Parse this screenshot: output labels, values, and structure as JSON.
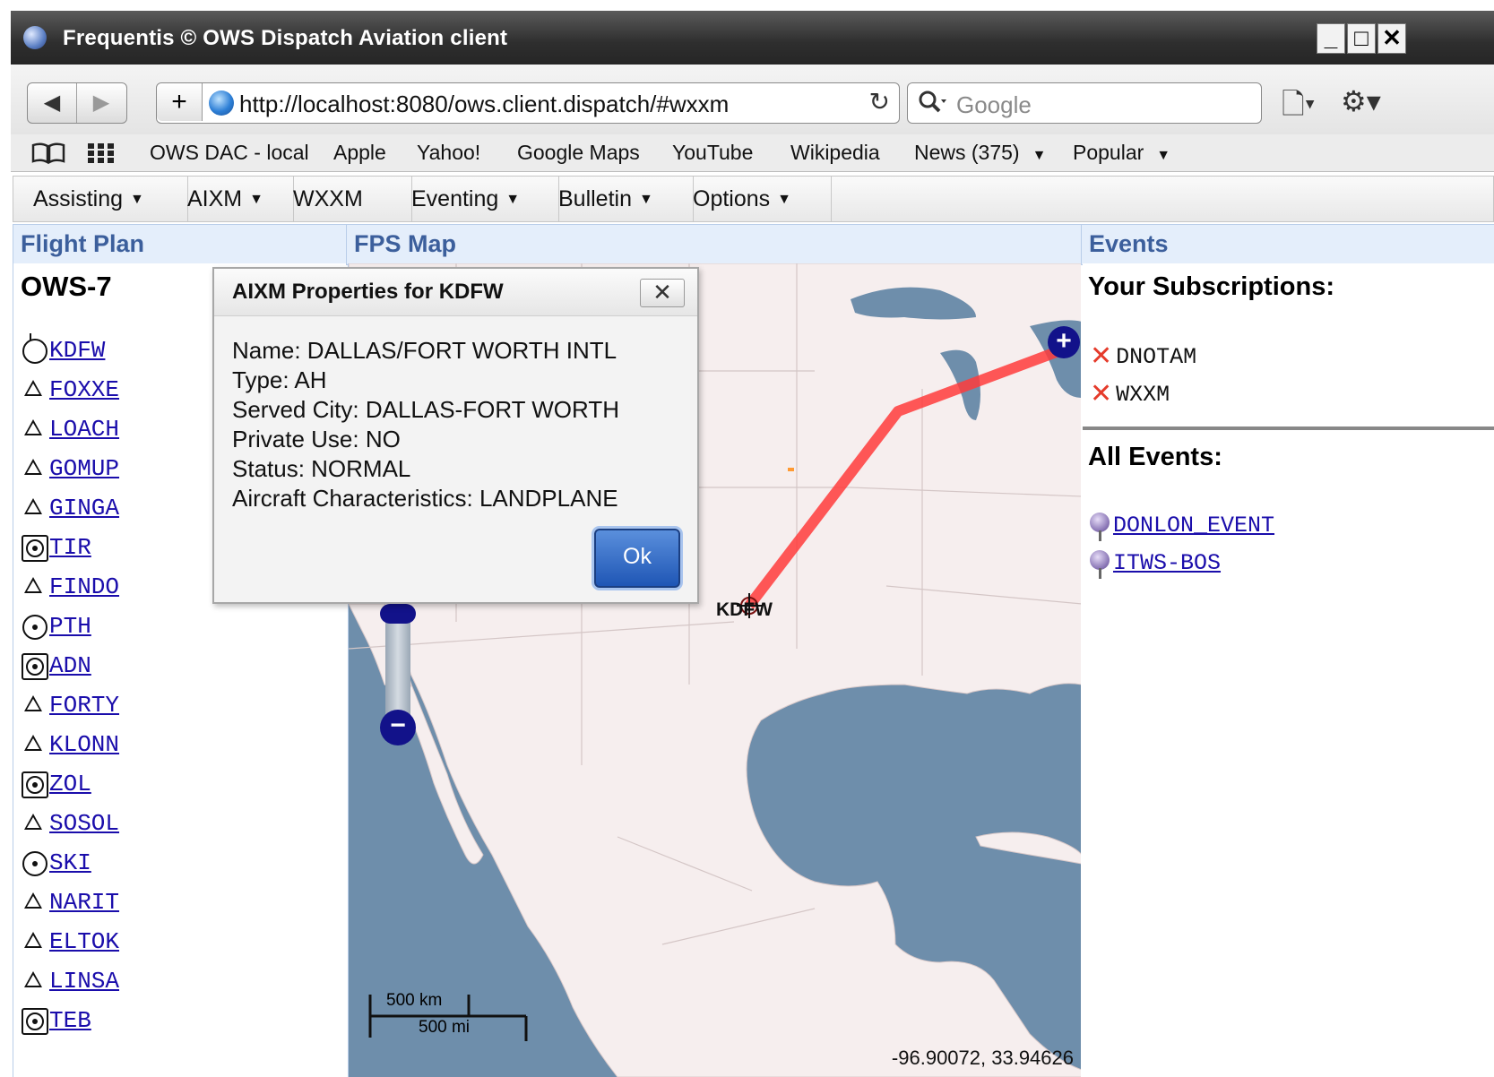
{
  "window": {
    "title": "Frequentis © OWS Dispatch Aviation client",
    "minimize": "_",
    "maximize": "□",
    "close": "✕"
  },
  "toolbar": {
    "back": "◀",
    "forward": "▶",
    "add_bookmark": "+",
    "url": "http://localhost:8080/ows.client.dispatch/#wxxm",
    "reload": "↻",
    "search_placeholder": "Google",
    "search_icon": "search-icon",
    "page_menu": "🗋▾",
    "settings_menu": "⚙▾"
  },
  "bookmarks": {
    "icons": [
      "book-icon",
      "grid-icon"
    ],
    "items": [
      "OWS DAC - local",
      "Apple",
      "Yahoo!",
      "Google Maps",
      "YouTube",
      "Wikipedia",
      "News (375)",
      "Popular"
    ]
  },
  "menu": {
    "items": [
      "Assisting",
      "AIXM",
      "WXXM",
      "Eventing",
      "Bulletin",
      "Options"
    ]
  },
  "panels": {
    "flight_plan": "Flight Plan",
    "map": "FPS Map",
    "events": "Events"
  },
  "flight_plan": {
    "name": "OWS-7",
    "waypoints": [
      {
        "label": "KDFW",
        "symbol": "airport"
      },
      {
        "label": "FOXXE",
        "symbol": "triangle"
      },
      {
        "label": "LOACH",
        "symbol": "triangle"
      },
      {
        "label": "GOMUP",
        "symbol": "triangle"
      },
      {
        "label": "GINGA",
        "symbol": "triangle"
      },
      {
        "label": "TIR",
        "symbol": "vortac"
      },
      {
        "label": "FINDO",
        "symbol": "triangle"
      },
      {
        "label": "PTH",
        "symbol": "vor"
      },
      {
        "label": "ADN",
        "symbol": "vortac"
      },
      {
        "label": "FORTY",
        "symbol": "triangle"
      },
      {
        "label": "KLONN",
        "symbol": "triangle"
      },
      {
        "label": "ZOL",
        "symbol": "vortac"
      },
      {
        "label": "SOSOL",
        "symbol": "triangle"
      },
      {
        "label": "SKI",
        "symbol": "vor"
      },
      {
        "label": "NARIT",
        "symbol": "triangle"
      },
      {
        "label": "ELTOK",
        "symbol": "triangle"
      },
      {
        "label": "LINSA",
        "symbol": "triangle"
      },
      {
        "label": "TEB",
        "symbol": "vortac"
      }
    ]
  },
  "map": {
    "airport_label": "KDFW",
    "zoom_in": "+",
    "zoom_out": "−",
    "scale_km": "500 km",
    "scale_mi": "500 mi",
    "coordinates": "-96.90072, 33.94626",
    "colors": {
      "water": "#6e8eab",
      "land": "#f6eeee",
      "route": "#ff3b3b"
    }
  },
  "events": {
    "subscriptions_title": "Your Subscriptions:",
    "subscriptions": [
      "DNOTAM",
      "WXXM"
    ],
    "all_events_title": "All Events:",
    "events": [
      "DONLON_EVENT",
      "ITWS-BOS"
    ]
  },
  "dialog": {
    "title": "AIXM Properties for KDFW",
    "close": "✕",
    "lines": [
      "Name: DALLAS/FORT WORTH INTL",
      "Type: AH",
      "Served City: DALLAS-FORT WORTH",
      "Private Use: NO",
      "Status: NORMAL",
      "Aircraft Characteristics: LANDPLANE"
    ],
    "ok": "Ok"
  }
}
